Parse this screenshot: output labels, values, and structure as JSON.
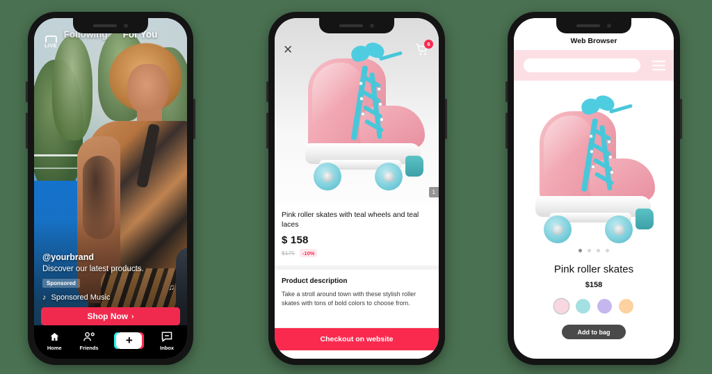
{
  "background_color": "#4a7151",
  "phone1": {
    "name": "tiktok-feed-phone",
    "top_tabs": [
      {
        "label": "Following",
        "active": false,
        "has_dot": true
      },
      {
        "label": "For You",
        "active": true,
        "has_dot": false
      }
    ],
    "live_badge": "LIVE",
    "handle": "@yourbrand",
    "caption": "Discover our latest products.",
    "sponsored_tag": "Sponsored",
    "music": "Sponsored Music",
    "music_icon": "music-note-icon",
    "cta": {
      "label": "Shop Now",
      "chevron": "›",
      "color": "#f02a4e"
    },
    "tabbar": [
      {
        "label": "Home",
        "icon": "home-icon"
      },
      {
        "label": "Friends",
        "icon": "friends-icon"
      },
      {
        "label": "",
        "icon": "plus-icon"
      },
      {
        "label": "Inbox",
        "icon": "inbox-icon"
      }
    ]
  },
  "phone2": {
    "name": "product-detail-phone",
    "close_icon": "close-icon",
    "cart_icon": "shopping-cart-icon",
    "cart_count": "6",
    "image_counter": "1",
    "title": "Pink roller skates with teal wheels and teal laces",
    "price": "$ 158",
    "original_price": "$175",
    "discount": "-10%",
    "section_title": "Product description",
    "description": "Take a stroll around town with these stylish roller skates with tons of bold colors to choose from.",
    "checkout_label": "Checkout on website",
    "checkout_color": "#fa2a4f"
  },
  "phone3": {
    "name": "web-browser-phone",
    "header_title": "Web Browser",
    "search_placeholder": "",
    "menu_icon": "hamburger-menu-icon",
    "bar_color": "#fcdfe5",
    "carousel_dots": 4,
    "active_dot": 0,
    "product_name": "Pink roller skates",
    "price": "$158",
    "swatches": [
      {
        "name": "pink",
        "color": "#f9d7e0",
        "selected": true
      },
      {
        "name": "teal",
        "color": "#a3e0e2",
        "selected": false
      },
      {
        "name": "lavender",
        "color": "#c6b6ee",
        "selected": false
      },
      {
        "name": "orange",
        "color": "#fbd2a0",
        "selected": false
      }
    ],
    "add_to_bag_label": "Add to bag"
  }
}
